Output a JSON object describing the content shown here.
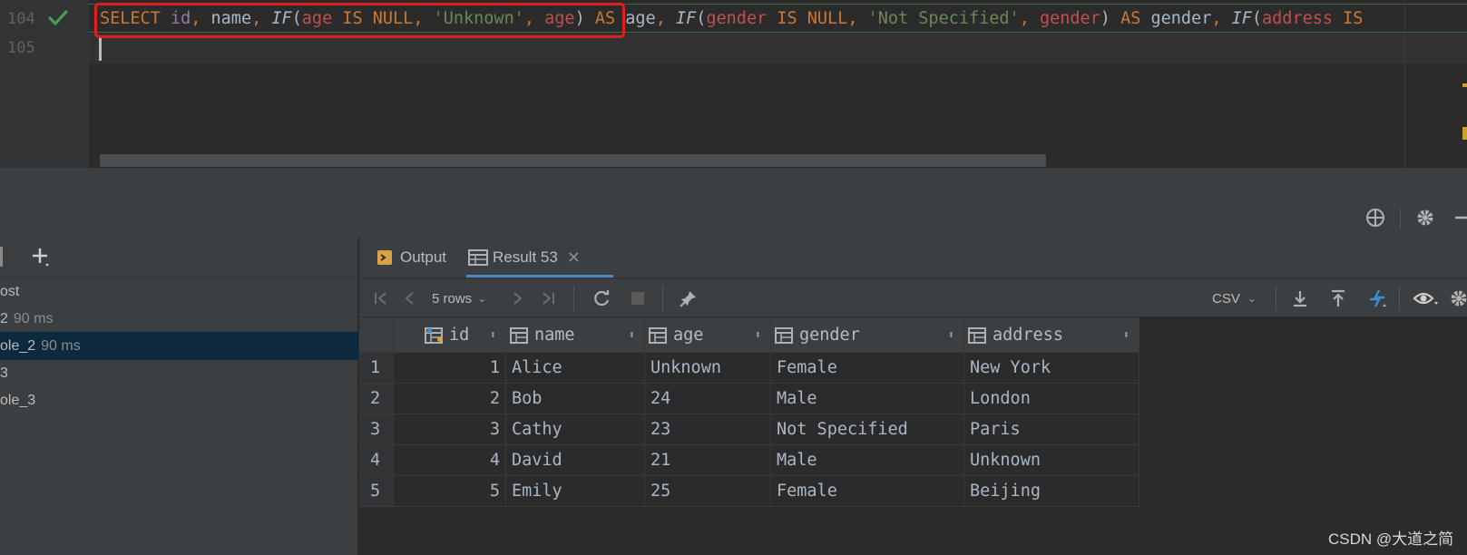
{
  "editor": {
    "line_numbers": [
      "104",
      "105"
    ],
    "line104_tokens": [
      {
        "t": "SELECT ",
        "c": "kw"
      },
      {
        "t": "id",
        "c": "col-id"
      },
      {
        "t": ", ",
        "c": "kw"
      },
      {
        "t": "name",
        "c": "plain"
      },
      {
        "t": ", ",
        "c": "kw"
      },
      {
        "t": "IF",
        "c": "fni"
      },
      {
        "t": "(",
        "c": "plain"
      },
      {
        "t": "age ",
        "c": "col-red"
      },
      {
        "t": "IS NULL",
        "c": "kw"
      },
      {
        "t": ", ",
        "c": "kw"
      },
      {
        "t": "'Unknown'",
        "c": "str"
      },
      {
        "t": ", ",
        "c": "kw"
      },
      {
        "t": "age",
        "c": "col-red"
      },
      {
        "t": ") ",
        "c": "plain"
      },
      {
        "t": "AS ",
        "c": "kw"
      },
      {
        "t": "age",
        "c": "plain"
      },
      {
        "t": ", ",
        "c": "kw"
      },
      {
        "t": "IF",
        "c": "fni"
      },
      {
        "t": "(",
        "c": "plain"
      },
      {
        "t": "gender ",
        "c": "col-red"
      },
      {
        "t": "IS NULL",
        "c": "kw"
      },
      {
        "t": ", ",
        "c": "kw"
      },
      {
        "t": "'Not Specified'",
        "c": "str"
      },
      {
        "t": ", ",
        "c": "kw"
      },
      {
        "t": "gender",
        "c": "col-red"
      },
      {
        "t": ") ",
        "c": "plain"
      },
      {
        "t": "AS ",
        "c": "kw"
      },
      {
        "t": "gender",
        "c": "plain"
      },
      {
        "t": ", ",
        "c": "kw"
      },
      {
        "t": "IF",
        "c": "fni"
      },
      {
        "t": "(",
        "c": "plain"
      },
      {
        "t": "address ",
        "c": "col-red"
      },
      {
        "t": "IS",
        "c": "kw"
      }
    ]
  },
  "left_panel": {
    "items": [
      {
        "label": "ost",
        "ms": ""
      },
      {
        "label": "2",
        "ms": "90 ms"
      },
      {
        "label": "ole_2",
        "ms": "90 ms"
      },
      {
        "label": "3",
        "ms": ""
      },
      {
        "label": "ole_3",
        "ms": ""
      }
    ],
    "selected_index": 2
  },
  "tabs": {
    "output": "Output",
    "result": "Result 53"
  },
  "result_toolbar": {
    "rows_label": "5 rows",
    "export_format": "CSV"
  },
  "grid": {
    "columns": [
      "id",
      "name",
      "age",
      "gender",
      "address"
    ],
    "rows": [
      {
        "n": "1",
        "cells": [
          "1",
          "Alice",
          "Unknown",
          "Female",
          "New York"
        ]
      },
      {
        "n": "2",
        "cells": [
          "2",
          "Bob",
          "24",
          "Male",
          "London"
        ]
      },
      {
        "n": "3",
        "cells": [
          "3",
          "Cathy",
          "23",
          "Not Specified",
          "Paris"
        ]
      },
      {
        "n": "4",
        "cells": [
          "4",
          "David",
          "21",
          "Male",
          "Unknown"
        ]
      },
      {
        "n": "5",
        "cells": [
          "5",
          "Emily",
          "25",
          "Female",
          "Beijing"
        ]
      }
    ]
  },
  "watermark": "CSDN @大道之简",
  "colors": {
    "keyword": "#cc7832",
    "string": "#6a8759",
    "column_ref": "#c0504d",
    "id_column": "#9876aa",
    "selection": "#0d293e",
    "highlight_box": "#e02020",
    "success_check": "#499c54"
  }
}
